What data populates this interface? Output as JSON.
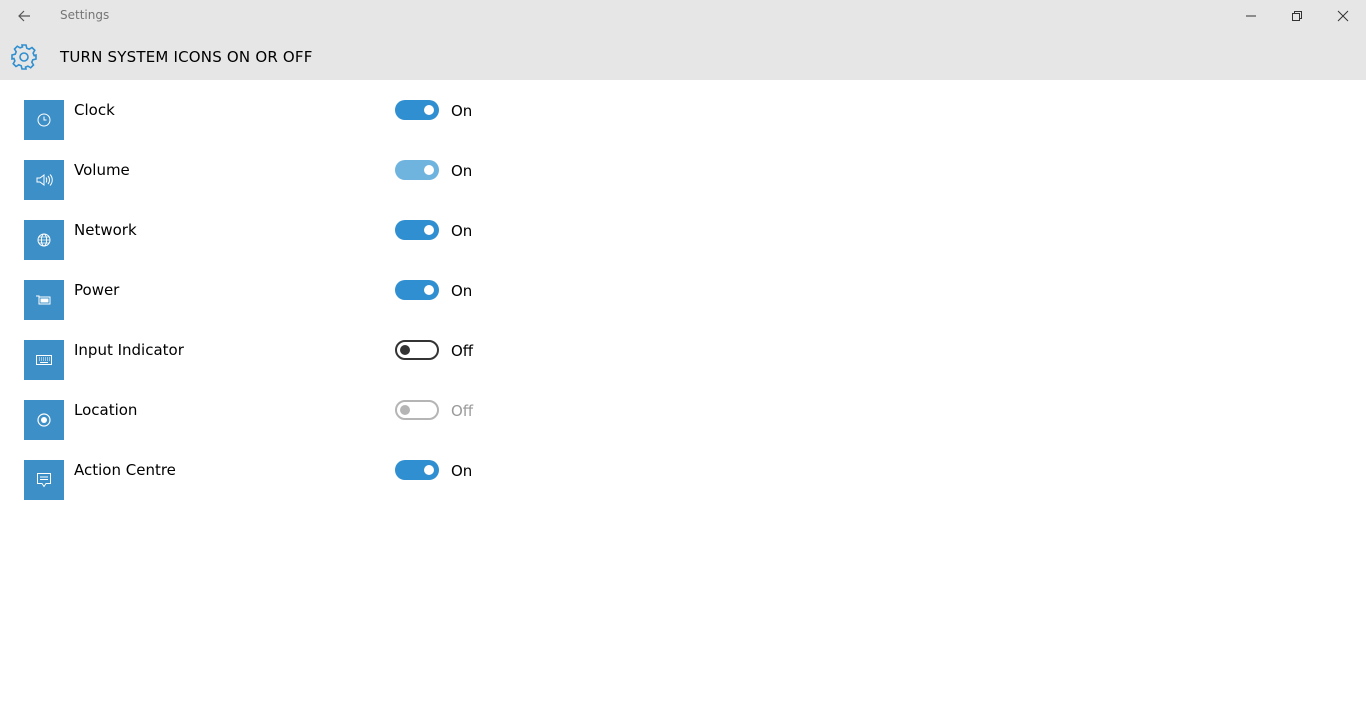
{
  "window": {
    "title": "Settings"
  },
  "header": {
    "title": "TURN SYSTEM ICONS ON OR OFF"
  },
  "accent_color": "#3d8fc7",
  "items": [
    {
      "label": "Clock",
      "state": "On",
      "icon": "clock-icon"
    },
    {
      "label": "Volume",
      "state": "On",
      "icon": "volume-icon"
    },
    {
      "label": "Network",
      "state": "On",
      "icon": "network-icon"
    },
    {
      "label": "Power",
      "state": "On",
      "icon": "power-icon"
    },
    {
      "label": "Input Indicator",
      "state": "Off",
      "icon": "keyboard-icon"
    },
    {
      "label": "Location",
      "state": "Off",
      "icon": "location-icon"
    },
    {
      "label": "Action Centre",
      "state": "On",
      "icon": "action-centre-icon"
    }
  ]
}
